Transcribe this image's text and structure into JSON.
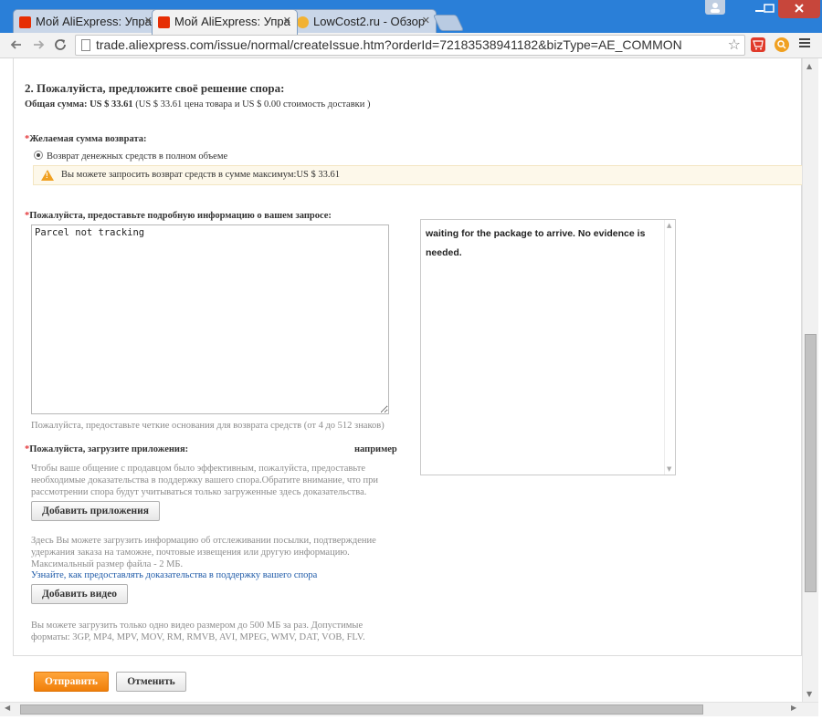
{
  "browser": {
    "tabs": [
      {
        "label": "Мой AliExpress: Упра"
      },
      {
        "label": "Мой AliExpress: Упра"
      },
      {
        "label": "LowCost2.ru - Обзор"
      }
    ],
    "url": "trade.aliexpress.com/issue/normal/createIssue.htm?orderId=72183538941182&bizType=AE_COMMON",
    "close_glyph": "✕",
    "icons": [
      "back-arrow-icon",
      "forward-arrow-icon",
      "reload-icon",
      "page-icon",
      "bookmark-star-icon",
      "aliexpress-cart-icon",
      "search-extension-icon",
      "menu-icon"
    ]
  },
  "form": {
    "section_title": "2. Пожалуйста, предложите своё решение спора:",
    "total_label": "Общая сумма:",
    "total_value": "US $ 33.61",
    "total_detail": "(US $ 33.61 цена товара и US $ 0.00 стоимость доставки )",
    "refund_label": "Желаемая сумма возврата:",
    "refund_option": "Возврат денежных средств в полном объеме",
    "refund_warning": "Вы можете запросить возврат средств в сумме максимум:US $ 33.61",
    "details_label": "Пожалуйста, предоставьте подробную информацию о вашем запросе:",
    "details_value": "Parcel not tracking",
    "details_hint": "Пожалуйста, предоставьте четкие основания для возврата средств (от 4 до 512 знаков)",
    "example_text": "waiting for the package to arrive. No evidence is needed.",
    "attach_label": "Пожалуйста, загрузите приложения:",
    "example_label": "например",
    "attach_hint": "Чтобы ваше общение с продавцом было эффективным, пожалуйста, предоставьте необходимые доказательства в поддержку вашего спора.Обратите внимание, что при рассмотрении спора будут учитываться только загруженные здесь доказательства.",
    "add_attachment_button": "Добавить приложения",
    "upload_hint": "Здесь Вы можете загрузить информацию об отслеживании посылки, подтверждение удержания заказа на таможне, почтовые извещения или другую информацию. Максимальный размер файла - 2 МБ.",
    "evidence_link": "Узнайте, как предоставлять доказательства в поддержку вашего спора",
    "add_video_button": "Добавить видео",
    "video_hint": "Вы можете загрузить только одно видео размером до 500 МБ за раз. Допустимые форматы: 3GP, MP4, MPV, MOV, RM, RMVB, AVI, MPEG, WMV, DAT, VOB, FLV.",
    "submit_button": "Отправить",
    "cancel_button": "Отменить",
    "required_mark": "*"
  },
  "colors": {
    "accent_orange": "#f08a1c",
    "required_red": "#e4393c",
    "link_blue": "#1e5aa8",
    "warning_bg": "#fdf8ea"
  }
}
